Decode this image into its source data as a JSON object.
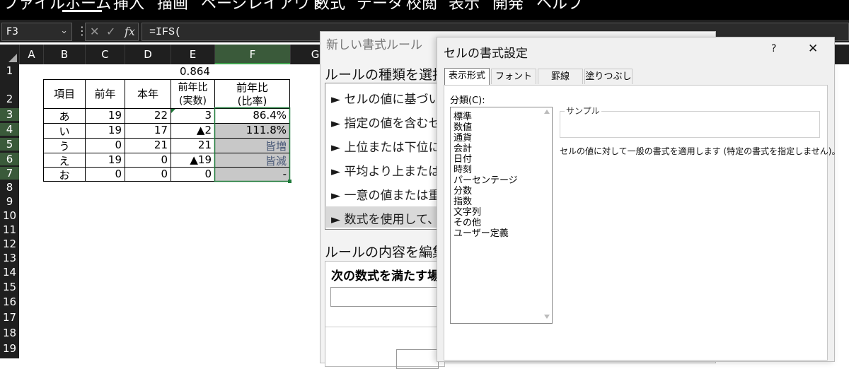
{
  "menu": [
    "ファイル",
    "ホーム",
    "挿入",
    "描画",
    "ページレイアウト",
    "数式",
    "データ",
    "校閲",
    "表示",
    "開発",
    "ヘルプ"
  ],
  "formula_bar": {
    "name_box": "F3",
    "name_box_chevron": "⌄",
    "more": "⋮",
    "cancel": "✕",
    "enter": "✓",
    "fx": "fx",
    "formula": "=IFS("
  },
  "columns": [
    "A",
    "B",
    "C",
    "D",
    "E",
    "F",
    "G"
  ],
  "rows": [
    "1",
    "2",
    "3",
    "4",
    "5",
    "6",
    "7",
    "8",
    "9",
    "10",
    "11",
    "12",
    "13",
    "14",
    "15",
    "16",
    "17",
    "18",
    "19"
  ],
  "sheet": {
    "e1": "0.864",
    "header": {
      "b": "項目",
      "c": "前年",
      "d": "本年",
      "e1": "前年比",
      "e2": "(実数)",
      "f1": "前年比",
      "f2": "(比率)"
    },
    "data": [
      {
        "b": "あ",
        "c": "19",
        "d": "22",
        "e": "3",
        "f": "86.4%"
      },
      {
        "b": "い",
        "c": "19",
        "d": "17",
        "e": "▲2",
        "f": "111.8%"
      },
      {
        "b": "う",
        "c": "0",
        "d": "21",
        "e": "21",
        "f": "皆増"
      },
      {
        "b": "え",
        "c": "19",
        "d": "0",
        "e": "▲19",
        "f": "皆減"
      },
      {
        "b": "お",
        "c": "0",
        "d": "0",
        "e": "0",
        "f": "-"
      }
    ]
  },
  "new_rule_dialog": {
    "title": "新しい書式ルール",
    "select_type_label": "ルールの種類を選択し",
    "rule_types": [
      "セルの値に基づい",
      "指定の値を含むセ",
      "上位または下位に",
      "平均より上または",
      "一意の値または重",
      "数式を使用して、書"
    ],
    "arrow": "►",
    "edit_label": "ルールの内容を編集し",
    "formula_label": "次の数式を満たす場"
  },
  "format_cells_dialog": {
    "title": "セルの書式設定",
    "help": "?",
    "close": "✕",
    "tabs": [
      "表示形式",
      "フォント",
      "罫線",
      "塗りつぶし"
    ],
    "category_label": "分類(C):",
    "categories": [
      "標準",
      "数値",
      "通貨",
      "会計",
      "日付",
      "時刻",
      "パーセンテージ",
      "分数",
      "指数",
      "文字列",
      "その他",
      "ユーザー定義"
    ],
    "sample_label": "サンプル",
    "description": "セルの値に対して一般の書式を適用します (特定の書式を指定しません)。"
  },
  "colors": {
    "menubar": "#000000",
    "excel_green": "#3fa34d",
    "gray_cell": "#c8c8c8"
  }
}
